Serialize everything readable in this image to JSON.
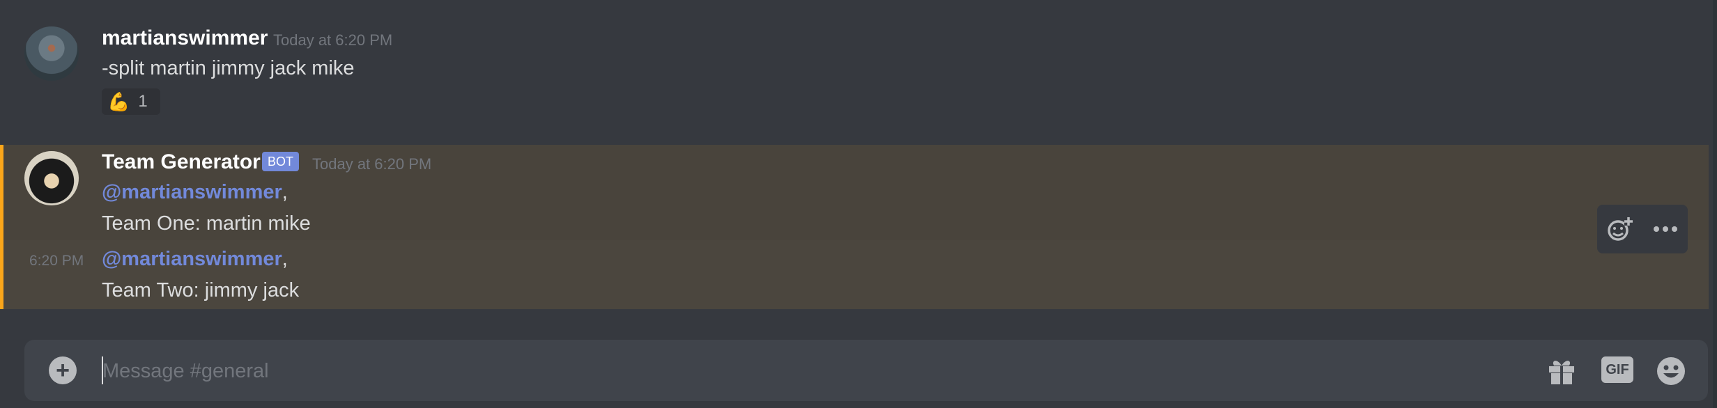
{
  "messages": [
    {
      "username": "martianswimmer",
      "timestamp": "Today at 6:20 PM",
      "content": "-split martin jimmy jack mike",
      "reaction": {
        "emoji": "💪",
        "count": "1"
      }
    },
    {
      "username": "Team Generator",
      "badge": "BOT",
      "timestamp": "Today at 6:20 PM",
      "lines": [
        {
          "mention": "@martianswimmer",
          "suffix": ","
        },
        {
          "text": "Team One:  martin  mike"
        }
      ]
    },
    {
      "side_timestamp": "6:20 PM",
      "lines": [
        {
          "mention": "@martianswimmer",
          "suffix": ","
        },
        {
          "text": "Team Two:  jimmy  jack"
        }
      ]
    }
  ],
  "composer": {
    "placeholder": "Message #general",
    "gif_label": "GIF"
  },
  "icons": {
    "add": "plus-circle-icon",
    "gift": "gift-icon",
    "gif": "gif-icon",
    "emoji": "emoji-icon",
    "add_reaction": "add-reaction-icon",
    "more": "more-options-icon"
  },
  "colors": {
    "background": "#36393f",
    "mention": "#7289da",
    "bot_badge": "#7289da",
    "highlight_bar": "#faa61a",
    "highlight_bg": "#49443c"
  }
}
